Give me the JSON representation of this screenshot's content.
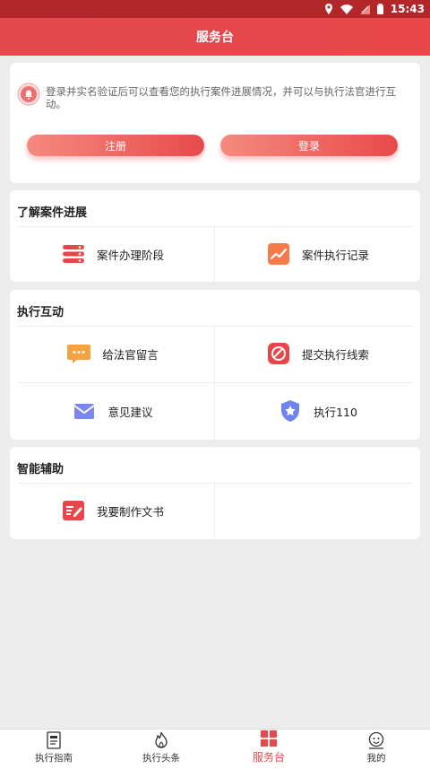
{
  "status_bar": {
    "time": "15:43"
  },
  "title": "服务台",
  "login_card": {
    "notice": "登录并实名验证后可以查看您的执行案件进展情况，并可以与执行法官进行互动。",
    "register_label": "注册",
    "login_label": "登录"
  },
  "progress_section": {
    "title": "了解案件进展",
    "items": [
      {
        "label": "案件办理阶段"
      },
      {
        "label": "案件执行记录"
      }
    ]
  },
  "interact_section": {
    "title": "执行互动",
    "items": [
      {
        "label": "给法官留言"
      },
      {
        "label": "提交执行线索"
      },
      {
        "label": "意见建议"
      },
      {
        "label": "执行110"
      }
    ]
  },
  "assist_section": {
    "title": "智能辅助",
    "items": [
      {
        "label": "我要制作文书"
      }
    ]
  },
  "tabs": [
    {
      "label": "执行指南"
    },
    {
      "label": "执行头条"
    },
    {
      "label": "服务台"
    },
    {
      "label": "我的"
    }
  ],
  "colors": {
    "accent": "#e24a4d",
    "status_bar": "#b3272b"
  }
}
